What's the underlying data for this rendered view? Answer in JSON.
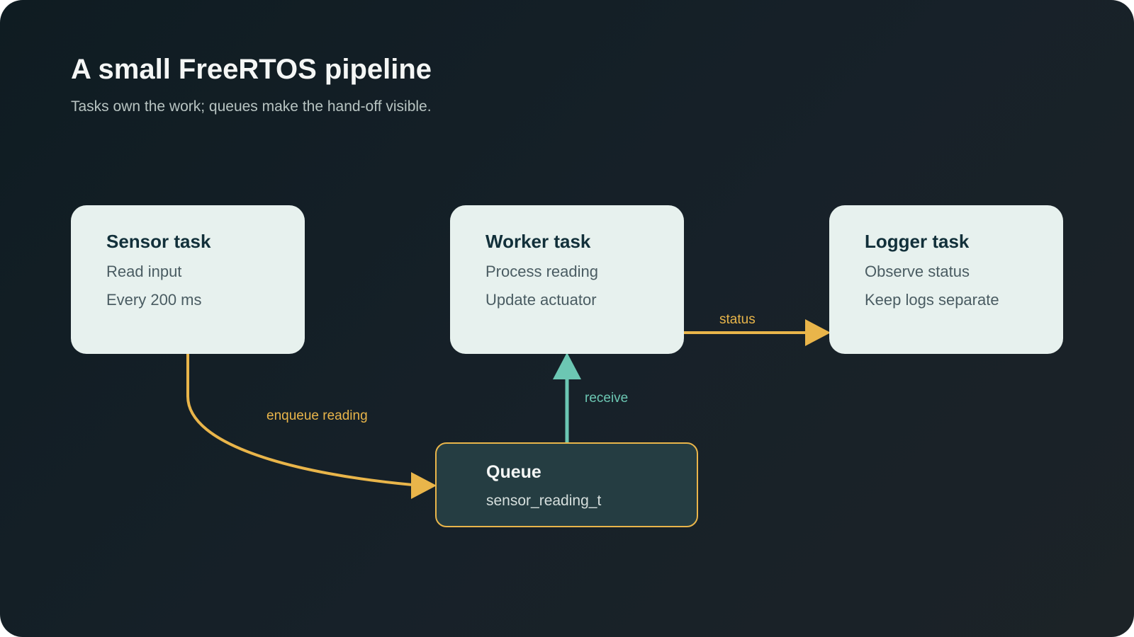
{
  "title": "A small FreeRTOS pipeline",
  "subtitle": "Tasks own the work; queues make the hand-off visible.",
  "nodes": [
    {
      "title": "Sensor task",
      "lines": [
        "Read input",
        "Every 200 ms"
      ]
    },
    {
      "title": "Worker task",
      "lines": [
        "Process reading",
        "Update actuator"
      ]
    },
    {
      "title": "Logger task",
      "lines": [
        "Observe status",
        "Keep logs separate"
      ]
    }
  ],
  "queue": {
    "title": "Queue",
    "subtitle": "sensor_reading_t"
  },
  "edges": [
    {
      "from": "Sensor task",
      "to": "Queue",
      "label": "enqueue reading",
      "color": "#e9b54a"
    },
    {
      "from": "Queue",
      "to": "Worker task",
      "label": "receive",
      "color": "#6cc7b3"
    },
    {
      "from": "Worker task",
      "to": "Logger task",
      "label": "status",
      "color": "#e9b54a"
    }
  ]
}
